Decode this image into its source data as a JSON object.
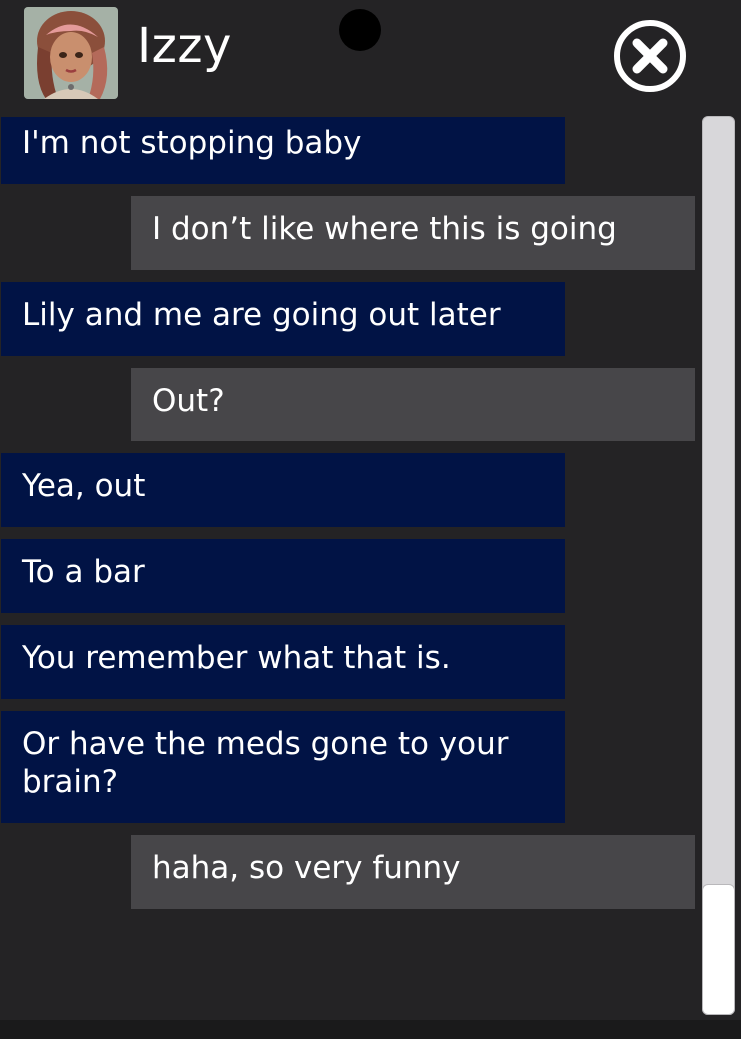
{
  "header": {
    "contact_name": "Izzy",
    "avatar_icon": "profile-photo",
    "close_icon": "circle-x-icon"
  },
  "colors": {
    "background": "#242325",
    "incoming_bubble": "#011345",
    "outgoing_bubble": "#474649",
    "text": "#ffffff"
  },
  "messages": [
    {
      "from": "contact",
      "text": "I'm not stopping baby"
    },
    {
      "from": "me",
      "text": "I don’t like where this is going"
    },
    {
      "from": "contact",
      "text": "Lily and me are going out later"
    },
    {
      "from": "me",
      "text": "Out?"
    },
    {
      "from": "contact",
      "text": "Yea, out"
    },
    {
      "from": "contact",
      "text": "To a bar"
    },
    {
      "from": "contact",
      "text": "You remember what that is."
    },
    {
      "from": "contact",
      "text": "Or have the meds gone to your brain?"
    },
    {
      "from": "me",
      "text": "haha, so very funny"
    }
  ]
}
